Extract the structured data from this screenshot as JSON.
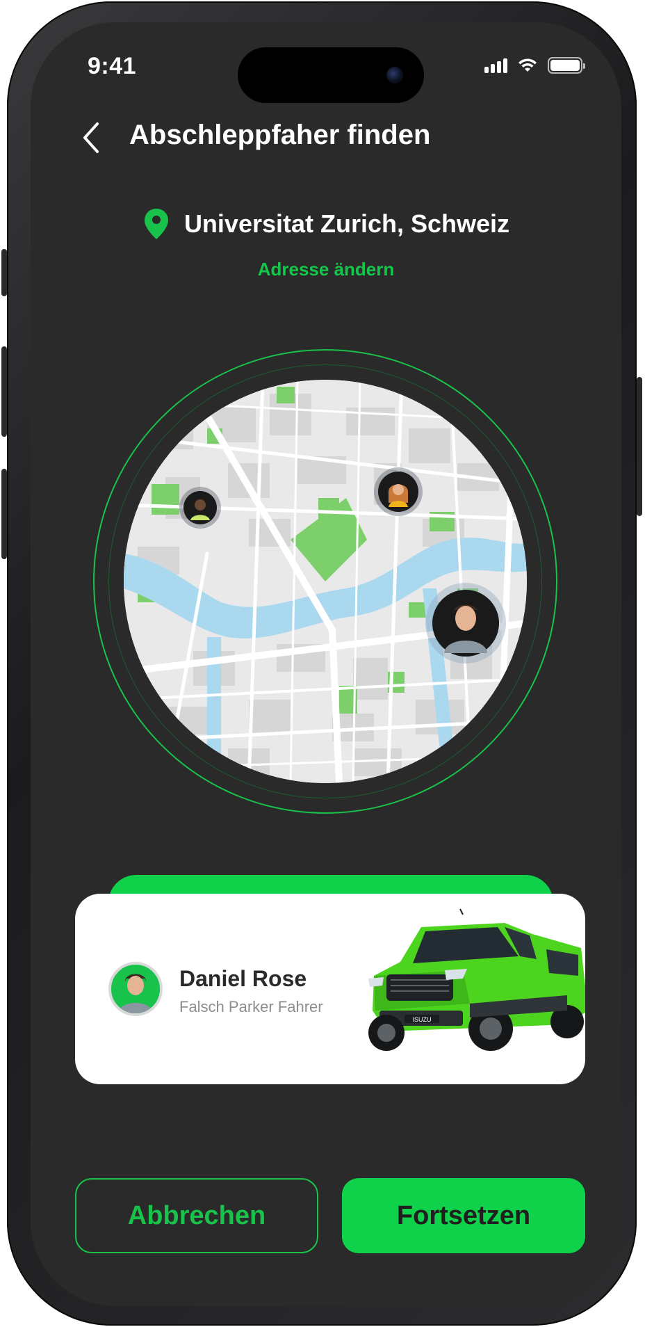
{
  "status_bar": {
    "time": "9:41"
  },
  "header": {
    "title": "Abschleppfaher finden"
  },
  "location": {
    "address": "Universitat Zurich, Schweiz",
    "change_label": "Adresse ändern"
  },
  "driver_card": {
    "name": "Daniel Rose",
    "role": "Falsch Parker Fahrer"
  },
  "truck": {
    "badge": "ISUZU"
  },
  "actions": {
    "cancel_label": "Abbrechen",
    "continue_label": "Fortsetzen"
  },
  "colors": {
    "accent": "#19c24b",
    "background": "#2a2a2a",
    "water": "#a9d8ef",
    "park": "#7ccf6a"
  },
  "icons": [
    "back-chevron-icon",
    "location-pin-icon",
    "signal-icon",
    "wifi-icon",
    "battery-icon"
  ]
}
